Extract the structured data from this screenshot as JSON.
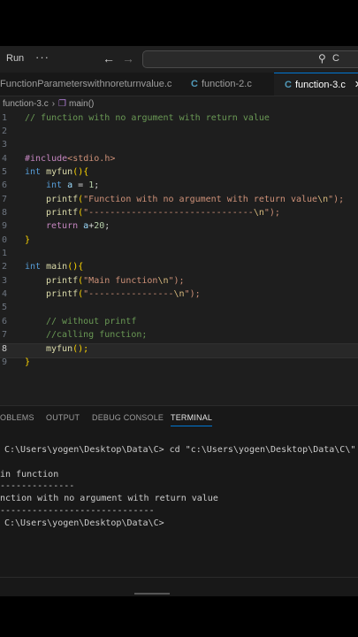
{
  "toolbar": {
    "run_label": "Run",
    "more_label": "···",
    "back_icon": "arrow-left-icon",
    "forward_icon": "arrow-right-icon",
    "search_text": "C"
  },
  "tabs": [
    {
      "label": "FunctionParameterswithnoreturnvalue.c",
      "icon": "C",
      "active": false
    },
    {
      "label": "function-2.c",
      "icon": "C",
      "active": false
    },
    {
      "label": "function-3.c",
      "icon": "C",
      "active": true
    }
  ],
  "breadcrumb": {
    "file": "function-3.c",
    "symbol": "main()"
  },
  "editor": {
    "line_numbers": [
      "1",
      "2",
      "3",
      "4",
      "5",
      "6",
      "7",
      "8",
      "9",
      "0",
      "1",
      "2",
      "3",
      "4",
      "5",
      "6",
      "7",
      "8",
      "9"
    ],
    "lines": {
      "l1": "// function with no argument with return value",
      "l4_pp": "#include",
      "l4_inc": "<stdio.h>",
      "l5_kw": "int",
      "l5_fn": "myfun",
      "l5_rest": "(){",
      "l6_kw": "int",
      "l6_var": "a",
      "l6_op": " = ",
      "l6_num": "1",
      "l6_end": ";",
      "l7_fn": "printf",
      "l7_open": "(",
      "l7_str": "\"Function with no argument with return value",
      "l7_esc": "\\n",
      "l7_close": "\");",
      "l8_fn": "printf",
      "l8_open": "(",
      "l8_str": "\"-------------------------------",
      "l8_esc": "\\n",
      "l8_close": "\");",
      "l9_kw": "return",
      "l9_var": "a",
      "l9_op": "+",
      "l9_num": "20",
      "l9_end": ";",
      "l10": "}",
      "l12_kw": "int",
      "l12_fn": "main",
      "l12_rest": "(){",
      "l13_fn": "printf",
      "l13_open": "(",
      "l13_str": "\"Main function",
      "l13_esc": "\\n",
      "l13_close": "\");",
      "l14_fn": "printf",
      "l14_open": "(",
      "l14_str": "\"----------------",
      "l14_esc": "\\n",
      "l14_close": "\");",
      "l16": "// without printf",
      "l17": "//calling function;",
      "l18_fn": "myfun",
      "l18_end": "();",
      "l19": "}"
    }
  },
  "panel": {
    "tabs": [
      "OBLEMS",
      "OUTPUT",
      "DEBUG CONSOLE",
      "TERMINAL"
    ],
    "active_tab": "TERMINAL",
    "terminal": [
      "C:\\Users\\yogen\\Desktop\\Data\\C> cd \"c:\\Users\\yogen\\Desktop\\Data\\C\\\" ; if",
      "in function",
      "--------------",
      "nction with no argument with return value",
      "-----------------------------",
      "C:\\Users\\yogen\\Desktop\\Data\\C>"
    ]
  },
  "colors": {
    "accent": "#0078d4",
    "c_icon": "#519aba",
    "editor_bg": "#1e1e1e"
  }
}
